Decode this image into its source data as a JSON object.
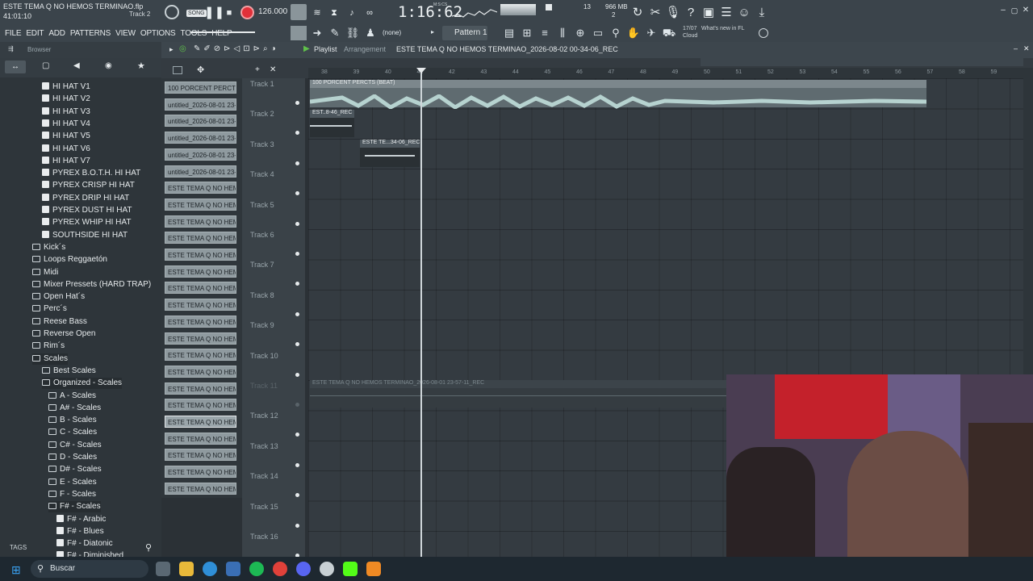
{
  "window": {
    "file_title": "ESTE TEMA Q NO HEMOS TERMINAO.flp",
    "time_readout": "41:01:10",
    "hint_track": "Track 2",
    "song_mode": "SONG",
    "tempo": "126.000",
    "time_display": "1:16:62",
    "time_units": "M:S:CS",
    "cpu_num": "13",
    "memory": "966 MB",
    "voices": "2",
    "news_date": "17/07",
    "news_text": "What's new in FL",
    "news_sub": "Cloud"
  },
  "menu": [
    "FILE",
    "EDIT",
    "ADD",
    "PATTERNS",
    "VIEW",
    "OPTIONS",
    "TOOLS",
    "HELP"
  ],
  "toolbar2": {
    "snap": "(none)",
    "pattern": "Pattern 1"
  },
  "browser": {
    "title": "Browser",
    "tags_label": "TAGS",
    "items": [
      {
        "label": "HI HAT V1",
        "type": "file",
        "indent": 2
      },
      {
        "label": "HI HAT V2",
        "type": "file",
        "indent": 2
      },
      {
        "label": "HI HAT V3",
        "type": "file",
        "indent": 2
      },
      {
        "label": "HI HAT V4",
        "type": "file",
        "indent": 2
      },
      {
        "label": "HI HAT V5",
        "type": "file",
        "indent": 2
      },
      {
        "label": "HI HAT V6",
        "type": "file",
        "indent": 2
      },
      {
        "label": "HI HAT V7",
        "type": "file",
        "indent": 2
      },
      {
        "label": "PYREX B.O.T.H. HI HAT",
        "type": "file",
        "indent": 2
      },
      {
        "label": "PYREX CRISP HI HAT",
        "type": "file",
        "indent": 2
      },
      {
        "label": "PYREX DRIP HI HAT",
        "type": "file",
        "indent": 2
      },
      {
        "label": "PYREX DUST HI HAT",
        "type": "file",
        "indent": 2
      },
      {
        "label": "PYREX WHIP HI HAT",
        "type": "file",
        "indent": 2
      },
      {
        "label": "SOUTHSIDE HI HAT",
        "type": "file",
        "indent": 2
      },
      {
        "label": "Kick´s",
        "type": "folder",
        "indent": 1
      },
      {
        "label": "Loops Reggaetón",
        "type": "folder",
        "indent": 1
      },
      {
        "label": "Midi",
        "type": "folder",
        "indent": 1
      },
      {
        "label": "Mixer Pressets (HARD TRAP)",
        "type": "folder",
        "indent": 1
      },
      {
        "label": "Open Hat´s",
        "type": "folder",
        "indent": 1
      },
      {
        "label": "Perc´s",
        "type": "folder",
        "indent": 1
      },
      {
        "label": "Reese Bass",
        "type": "folder",
        "indent": 1
      },
      {
        "label": "Reverse Open",
        "type": "folder",
        "indent": 1
      },
      {
        "label": "Rim´s",
        "type": "folder",
        "indent": 1
      },
      {
        "label": "Scales",
        "type": "folder",
        "indent": 1
      },
      {
        "label": "Best Scales",
        "type": "folder",
        "indent": 2
      },
      {
        "label": "Organized - Scales",
        "type": "folder",
        "indent": 2
      },
      {
        "label": "A - Scales",
        "type": "folder",
        "indent": 3
      },
      {
        "label": "A# - Scales",
        "type": "folder",
        "indent": 3
      },
      {
        "label": "B - Scales",
        "type": "folder",
        "indent": 3
      },
      {
        "label": "C - Scales",
        "type": "folder",
        "indent": 3
      },
      {
        "label": "C# - Scales",
        "type": "folder",
        "indent": 3
      },
      {
        "label": "D - Scales",
        "type": "folder",
        "indent": 3
      },
      {
        "label": "D# - Scales",
        "type": "folder",
        "indent": 3
      },
      {
        "label": "E - Scales",
        "type": "folder",
        "indent": 3
      },
      {
        "label": "F - Scales",
        "type": "folder",
        "indent": 3
      },
      {
        "label": "F# - Scales",
        "type": "folder",
        "indent": 3
      },
      {
        "label": "F# - Arabic",
        "type": "file",
        "indent": 4
      },
      {
        "label": "F# - Blues",
        "type": "file",
        "indent": 4
      },
      {
        "label": "F# - Diatonic",
        "type": "file",
        "indent": 4
      },
      {
        "label": "F# - Diminished",
        "type": "file",
        "indent": 4
      }
    ]
  },
  "playlist": {
    "title": "Playlist",
    "sub": "Arrangement",
    "clip_name": "ESTE TEMA Q NO HEMOS TERMINAO_2026-08-02 00-34-06_REC",
    "ruler": [
      "38",
      "39",
      "40",
      "41",
      "42",
      "43",
      "44",
      "45",
      "46",
      "47",
      "48",
      "49",
      "50",
      "51",
      "52",
      "53",
      "54",
      "55",
      "56",
      "57",
      "58",
      "59"
    ],
    "tracks": [
      "Track 1",
      "Track 2",
      "Track 3",
      "Track 4",
      "Track 5",
      "Track 6",
      "Track 7",
      "Track 8",
      "Track 9",
      "Track 10",
      "Track 11",
      "Track 12",
      "Track 13",
      "Track 14",
      "Track 15",
      "Track 16"
    ],
    "clips": {
      "c1": "100 PORCENT PERCTS (BEAT)",
      "c2": "EST..8-46_REC",
      "c3": "ESTE TE...34-06_REC",
      "c4": "ESTE TEMA Q NO HEMOS TERMINAO_2026-08-01 23-57-11_REC"
    }
  },
  "channels": [
    "100 PORCENT PERCTS...",
    "untitled_2026-08-01 23-...",
    "untitled_2026-08-01 23-...",
    "untitled_2026-08-01 23-...",
    "untitled_2026-08-01 23-...",
    "untitled_2026-08-01 23-...",
    "ESTE TEMA Q NO HEMOS T...",
    "ESTE TEMA Q NO HEMOS T...",
    "ESTE TEMA Q NO HEMOS T...",
    "ESTE TEMA Q NO HEMOS T...",
    "ESTE TEMA Q NO HEMOS T...",
    "ESTE TEMA Q NO HEMOS T...",
    "ESTE TEMA Q NO HEMOS T...",
    "ESTE TEMA Q NO HEMOS T...",
    "ESTE TEMA Q NO HEMOS T...",
    "ESTE TEMA Q NO HEMOS T...",
    "ESTE TEMA Q NO HEMOS T...",
    "ESTE TEMA Q NO HEMOS T...",
    "ESTE TEMA Q NO HEMOS T...",
    "ESTE TEMA Q NO HEMOS T...",
    "ESTE TEMA Q NO HEMOS T...",
    "ESTE TEMA Q NO HEMOS T...",
    "ESTE TEMA Q NO HEMOS T...",
    "ESTE TEMA Q NO HEMOS T...",
    "ESTE TEMA Q NO HEMOS T..."
  ],
  "taskbar": {
    "search_placeholder": "Buscar"
  },
  "colors": {
    "accent_record": "#e0313a",
    "panel": "#3b444b",
    "clip": "#8f9a9f"
  }
}
